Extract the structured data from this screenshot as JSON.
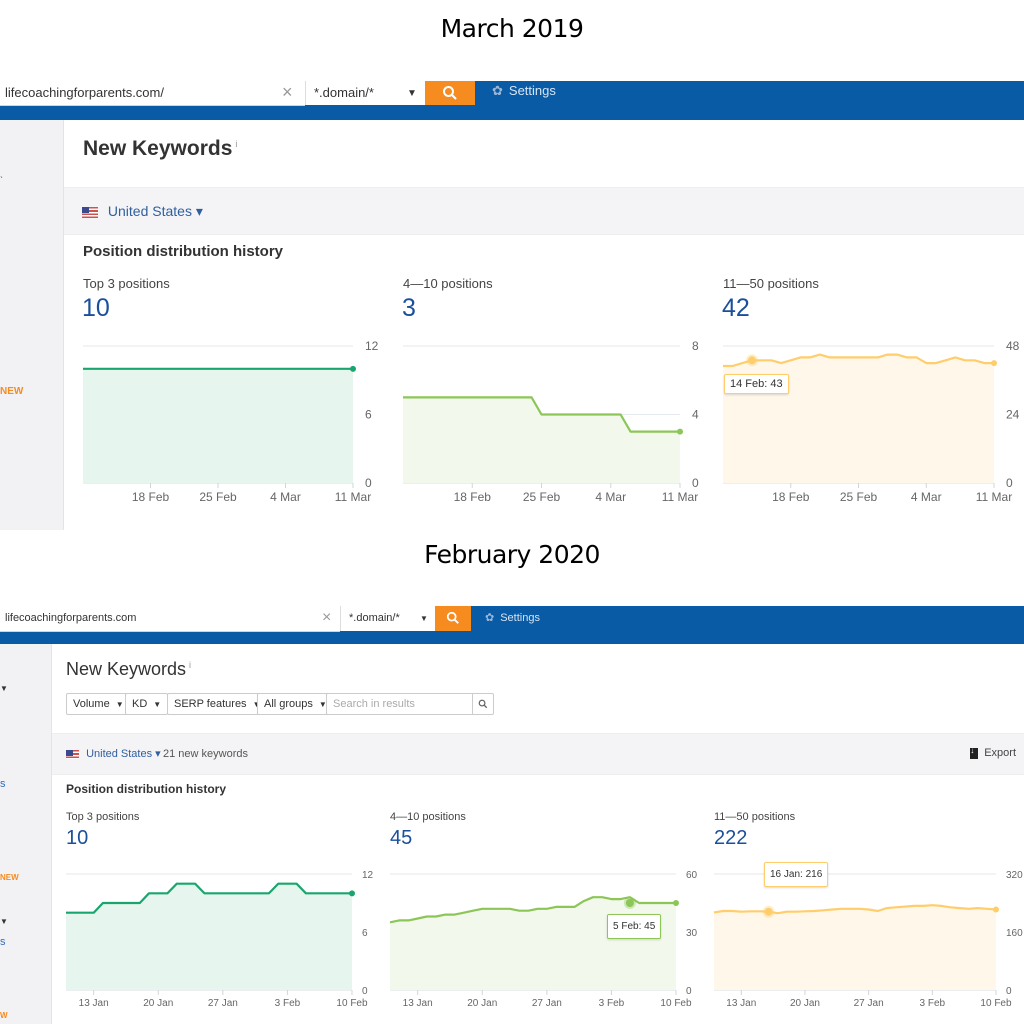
{
  "captions": {
    "top": "March 2019",
    "bottom": "February 2020"
  },
  "snap2019": {
    "search_value": "lifecoachingforparents.com/",
    "mode_value": "*.domain/*",
    "settings_label": "Settings",
    "sidebar_new_label": "NEW",
    "page_title": "New Keywords",
    "info_mark": "i",
    "country": "United States ▾",
    "section_title": "Position distribution history",
    "metrics": [
      {
        "label": "Top 3 positions",
        "value": "10"
      },
      {
        "label": "4—10 positions",
        "value": "3"
      },
      {
        "label": "11—50 positions",
        "value": "42"
      }
    ],
    "tooltip": "14 Feb: 43"
  },
  "snap2020": {
    "search_value": "lifecoachingforparents.com",
    "mode_value": "*.domain/*",
    "settings_label": "Settings",
    "sidebar_new_label": "NEW",
    "page_title": "New Keywords",
    "info_mark": "i",
    "filters": [
      "Volume",
      "KD",
      "SERP features",
      "All groups"
    ],
    "search_placeholder": "Search in results",
    "country": "United States ▾",
    "new_keywords_count": "21 new keywords",
    "export_label": "Export",
    "section_title": "Position distribution history",
    "metrics": [
      {
        "label": "Top 3 positions",
        "value": "10"
      },
      {
        "label": "4—10 positions",
        "value": "45"
      },
      {
        "label": "11—50 positions",
        "value": "222"
      }
    ],
    "tooltips": [
      "5 Feb: 45",
      "16 Jan: 216"
    ]
  },
  "colors": {
    "topbar": "#0a5ba5",
    "search_button": "#f68b1f",
    "top3": "#1aa56e",
    "top3_fill": "#e6f6ef",
    "pos4_10": "#8cc657",
    "pos4_10_fill": "#f2f9ec",
    "pos11_50": "#ffcd6b",
    "pos11_50_fill": "#fff8ea",
    "metric_value": "#1a4f9c"
  },
  "chart_data": [
    {
      "id": "2019-top3",
      "type": "area",
      "title": "Top 3 positions",
      "x": [
        "11 Feb",
        "12 Feb",
        "13 Feb",
        "14 Feb",
        "15 Feb",
        "16 Feb",
        "17 Feb",
        "18 Feb",
        "19 Feb",
        "20 Feb",
        "21 Feb",
        "22 Feb",
        "23 Feb",
        "24 Feb",
        "25 Feb",
        "26 Feb",
        "27 Feb",
        "28 Feb",
        "1 Mar",
        "2 Mar",
        "3 Mar",
        "4 Mar",
        "5 Mar",
        "6 Mar",
        "7 Mar",
        "8 Mar",
        "9 Mar",
        "10 Mar",
        "11 Mar"
      ],
      "values": [
        10,
        10,
        10,
        10,
        10,
        10,
        10,
        10,
        10,
        10,
        10,
        10,
        10,
        10,
        10,
        10,
        10,
        10,
        10,
        10,
        10,
        10,
        10,
        10,
        10,
        10,
        10,
        10,
        10
      ],
      "xticks": [
        "18 Feb",
        "25 Feb",
        "4 Mar",
        "11 Mar"
      ],
      "yticks": [
        0,
        6,
        12
      ],
      "ylim": [
        0,
        12
      ],
      "grid": true
    },
    {
      "id": "2019-pos4-10",
      "type": "area",
      "title": "4—10 positions",
      "x": [
        "11 Feb",
        "12 Feb",
        "13 Feb",
        "14 Feb",
        "15 Feb",
        "16 Feb",
        "17 Feb",
        "18 Feb",
        "19 Feb",
        "20 Feb",
        "21 Feb",
        "22 Feb",
        "23 Feb",
        "24 Feb",
        "25 Feb",
        "26 Feb",
        "27 Feb",
        "28 Feb",
        "1 Mar",
        "2 Mar",
        "3 Mar",
        "4 Mar",
        "5 Mar",
        "6 Mar",
        "7 Mar",
        "8 Mar",
        "9 Mar",
        "10 Mar",
        "11 Mar"
      ],
      "values": [
        5,
        5,
        5,
        5,
        5,
        5,
        5,
        5,
        5,
        5,
        5,
        5,
        5,
        5,
        4,
        4,
        4,
        4,
        4,
        4,
        4,
        4,
        4,
        3,
        3,
        3,
        3,
        3,
        3
      ],
      "xticks": [
        "18 Feb",
        "25 Feb",
        "4 Mar",
        "11 Mar"
      ],
      "yticks": [
        0,
        4,
        8
      ],
      "ylim": [
        0,
        8
      ],
      "grid": true
    },
    {
      "id": "2019-pos11-50",
      "type": "area",
      "title": "11—50 positions",
      "x": [
        "11 Feb",
        "12 Feb",
        "13 Feb",
        "14 Feb",
        "15 Feb",
        "16 Feb",
        "17 Feb",
        "18 Feb",
        "19 Feb",
        "20 Feb",
        "21 Feb",
        "22 Feb",
        "23 Feb",
        "24 Feb",
        "25 Feb",
        "26 Feb",
        "27 Feb",
        "28 Feb",
        "1 Mar",
        "2 Mar",
        "3 Mar",
        "4 Mar",
        "5 Mar",
        "6 Mar",
        "7 Mar",
        "8 Mar",
        "9 Mar",
        "10 Mar",
        "11 Mar"
      ],
      "values": [
        41,
        41,
        42,
        43,
        43,
        43,
        42,
        43,
        44,
        44,
        45,
        44,
        44,
        44,
        44,
        44,
        44,
        45,
        45,
        44,
        44,
        42,
        42,
        43,
        44,
        43,
        43,
        42,
        42
      ],
      "xticks": [
        "18 Feb",
        "25 Feb",
        "4 Mar",
        "11 Mar"
      ],
      "yticks": [
        0,
        24,
        48
      ],
      "ylim": [
        0,
        48
      ],
      "grid": true,
      "highlight": {
        "x": "14 Feb",
        "value": 43
      }
    },
    {
      "id": "2020-top3",
      "type": "area",
      "title": "Top 3 positions",
      "x": [
        "10 Jan",
        "11 Jan",
        "12 Jan",
        "13 Jan",
        "14 Jan",
        "15 Jan",
        "16 Jan",
        "17 Jan",
        "18 Jan",
        "19 Jan",
        "20 Jan",
        "21 Jan",
        "22 Jan",
        "23 Jan",
        "24 Jan",
        "25 Jan",
        "26 Jan",
        "27 Jan",
        "28 Jan",
        "29 Jan",
        "30 Jan",
        "31 Jan",
        "1 Feb",
        "2 Feb",
        "3 Feb",
        "4 Feb",
        "5 Feb",
        "6 Feb",
        "7 Feb",
        "8 Feb",
        "9 Feb",
        "10 Feb"
      ],
      "values": [
        8,
        8,
        8,
        8,
        9,
        9,
        9,
        9,
        9,
        10,
        10,
        10,
        11,
        11,
        11,
        10,
        10,
        10,
        10,
        10,
        10,
        10,
        10,
        11,
        11,
        11,
        10,
        10,
        10,
        10,
        10,
        10
      ],
      "xticks": [
        "13 Jan",
        "20 Jan",
        "27 Jan",
        "3 Feb",
        "10 Feb"
      ],
      "yticks": [
        0,
        6,
        12
      ],
      "ylim": [
        0,
        12
      ],
      "grid": true
    },
    {
      "id": "2020-pos4-10",
      "type": "area",
      "title": "4—10 positions",
      "x": [
        "10 Jan",
        "11 Jan",
        "12 Jan",
        "13 Jan",
        "14 Jan",
        "15 Jan",
        "16 Jan",
        "17 Jan",
        "18 Jan",
        "19 Jan",
        "20 Jan",
        "21 Jan",
        "22 Jan",
        "23 Jan",
        "24 Jan",
        "25 Jan",
        "26 Jan",
        "27 Jan",
        "28 Jan",
        "29 Jan",
        "30 Jan",
        "31 Jan",
        "1 Feb",
        "2 Feb",
        "3 Feb",
        "4 Feb",
        "5 Feb",
        "6 Feb",
        "7 Feb",
        "8 Feb",
        "9 Feb",
        "10 Feb"
      ],
      "values": [
        35,
        36,
        36,
        37,
        38,
        38,
        39,
        39,
        40,
        41,
        42,
        42,
        42,
        42,
        41,
        41,
        42,
        42,
        43,
        43,
        43,
        46,
        48,
        48,
        47,
        47,
        48,
        45,
        45,
        45,
        45,
        45
      ],
      "xticks": [
        "13 Jan",
        "20 Jan",
        "27 Jan",
        "3 Feb",
        "10 Feb"
      ],
      "yticks": [
        0,
        30,
        60
      ],
      "ylim": [
        0,
        60
      ],
      "grid": true,
      "highlight": {
        "x": "5 Feb",
        "value": 45
      }
    },
    {
      "id": "2020-pos11-50",
      "type": "area",
      "title": "11—50 positions",
      "x": [
        "10 Jan",
        "11 Jan",
        "12 Jan",
        "13 Jan",
        "14 Jan",
        "15 Jan",
        "16 Jan",
        "17 Jan",
        "18 Jan",
        "19 Jan",
        "20 Jan",
        "21 Jan",
        "22 Jan",
        "23 Jan",
        "24 Jan",
        "25 Jan",
        "26 Jan",
        "27 Jan",
        "28 Jan",
        "29 Jan",
        "30 Jan",
        "31 Jan",
        "1 Feb",
        "2 Feb",
        "3 Feb",
        "4 Feb",
        "5 Feb",
        "6 Feb",
        "7 Feb",
        "8 Feb",
        "9 Feb",
        "10 Feb"
      ],
      "values": [
        214,
        218,
        218,
        216,
        217,
        217,
        216,
        212,
        216,
        216,
        217,
        218,
        220,
        222,
        224,
        224,
        224,
        222,
        218,
        226,
        228,
        230,
        232,
        232,
        234,
        232,
        228,
        226,
        224,
        226,
        224,
        222
      ],
      "xticks": [
        "13 Jan",
        "20 Jan",
        "27 Jan",
        "3 Feb",
        "10 Feb"
      ],
      "yticks": [
        0,
        160,
        320
      ],
      "ylim": [
        0,
        320
      ],
      "grid": true,
      "highlight": {
        "x": "16 Jan",
        "value": 216
      }
    }
  ]
}
